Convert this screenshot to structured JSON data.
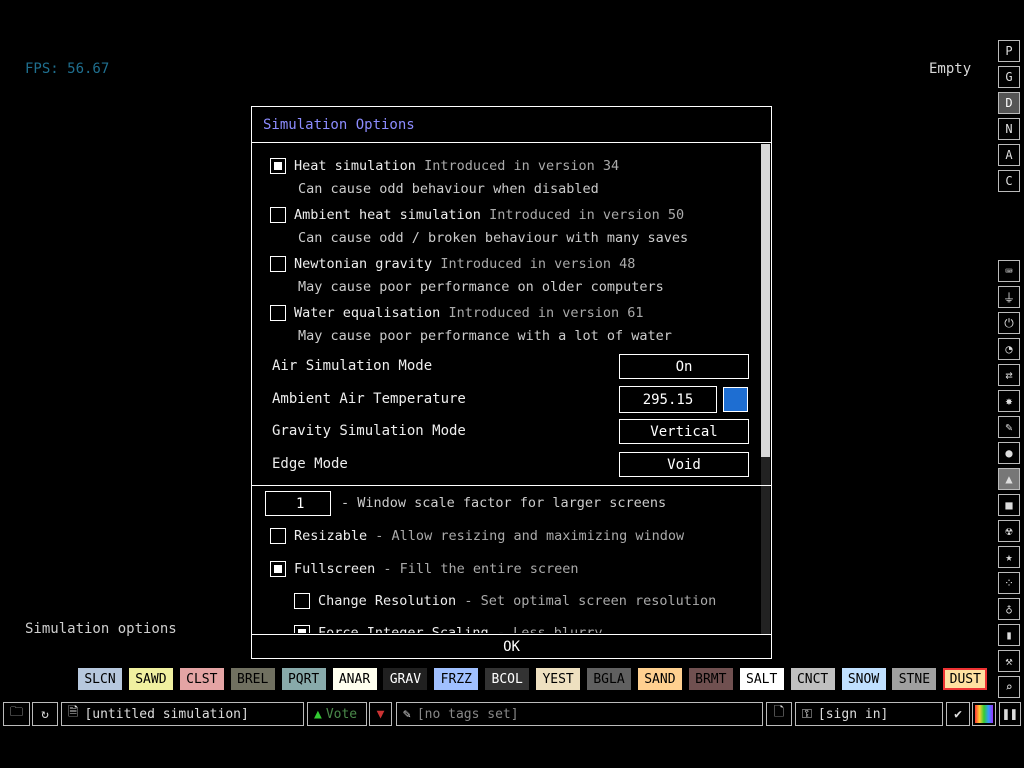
{
  "hud": {
    "fps": "FPS: 56.67",
    "status": "Empty",
    "hover_label": "Simulation options"
  },
  "right_menu": {
    "letters": [
      "P",
      "G",
      "D",
      "N",
      "A",
      "C"
    ],
    "selected_letter": "D",
    "icons": [
      "keyboard-icon",
      "plug-icon",
      "power-icon",
      "gauge-icon",
      "arrows-icon",
      "explosion-icon",
      "brush-icon",
      "drop-icon",
      "flask-icon",
      "square-icon",
      "radiation-icon",
      "star-icon",
      "dots-icon",
      "bulb-icon",
      "bookmark-icon",
      "hammer-icon",
      "search-icon"
    ],
    "selected_icon": "flask-icon"
  },
  "dialog": {
    "title": "Simulation Options",
    "options": [
      {
        "label": "Heat simulation",
        "note": "Introduced in version 34",
        "sub": "Can cause odd behaviour when disabled",
        "checked": true
      },
      {
        "label": "Ambient heat simulation",
        "note": "Introduced in version 50",
        "sub": "Can cause odd / broken behaviour with many saves",
        "checked": false
      },
      {
        "label": "Newtonian gravity",
        "note": "Introduced in version 48",
        "sub": "May cause poor performance on older computers",
        "checked": false
      },
      {
        "label": "Water equalisation",
        "note": "Introduced in version 61",
        "sub": "May cause poor performance with a lot of water",
        "checked": false
      }
    ],
    "air_mode": {
      "label": "Air Simulation Mode",
      "value": "On"
    },
    "ambient_temp": {
      "label": "Ambient Air Temperature",
      "value": "295.15",
      "swatch": "#1e6ed2"
    },
    "gravity_mode": {
      "label": "Gravity Simulation Mode",
      "value": "Vertical"
    },
    "edge_mode": {
      "label": "Edge Mode",
      "value": "Void"
    },
    "scale": {
      "value": "1",
      "label": "- Window scale factor for larger screens"
    },
    "resizable": {
      "label": "Resizable",
      "note": "- Allow resizing and maximizing window",
      "checked": false
    },
    "fullscreen": {
      "label": "Fullscreen",
      "note": "- Fill the entire screen",
      "checked": true
    },
    "change_res": {
      "label": "Change Resolution",
      "note": "- Set optimal screen resolution",
      "checked": false
    },
    "integer_scaling": {
      "label": "Force Integer Scaling",
      "note": "- Less blurry",
      "checked": true
    },
    "ok_label": "OK"
  },
  "elements": [
    {
      "name": "SLCN",
      "bg": "#b7c8de",
      "fg": "#000"
    },
    {
      "name": "SAWD",
      "bg": "#f0f0a0",
      "fg": "#000"
    },
    {
      "name": "CLST",
      "bg": "#e4a4a4",
      "fg": "#000"
    },
    {
      "name": "BREL",
      "bg": "#707060",
      "fg": "#000"
    },
    {
      "name": "PQRT",
      "bg": "#88aaaa",
      "fg": "#000"
    },
    {
      "name": "ANAR",
      "bg": "#ffffee",
      "fg": "#000"
    },
    {
      "name": "GRAV",
      "bg": "#202020",
      "fg": "#fff"
    },
    {
      "name": "FRZZ",
      "bg": "#a0c0ff",
      "fg": "#000"
    },
    {
      "name": "BCOL",
      "bg": "#333333",
      "fg": "#fff"
    },
    {
      "name": "YEST",
      "bg": "#eee0c0",
      "fg": "#000"
    },
    {
      "name": "BGLA",
      "bg": "#606060",
      "fg": "#000"
    },
    {
      "name": "SAND",
      "bg": "#ffd090",
      "fg": "#000"
    },
    {
      "name": "BRMT",
      "bg": "#705050",
      "fg": "#000"
    },
    {
      "name": "SALT",
      "bg": "#ffffff",
      "fg": "#000"
    },
    {
      "name": "CNCT",
      "bg": "#c0c0c0",
      "fg": "#000"
    },
    {
      "name": "SNOW",
      "bg": "#c0e0ff",
      "fg": "#000"
    },
    {
      "name": "STNE",
      "bg": "#a0a0a0",
      "fg": "#000"
    },
    {
      "name": "DUST",
      "bg": "#ffe0a0",
      "fg": "#000"
    }
  ],
  "selected_element": "DUST",
  "bottom": {
    "save_name": "[untitled simulation]",
    "vote_label": "Vote",
    "tags_placeholder": "[no tags set]",
    "login_label": "[sign in]"
  }
}
